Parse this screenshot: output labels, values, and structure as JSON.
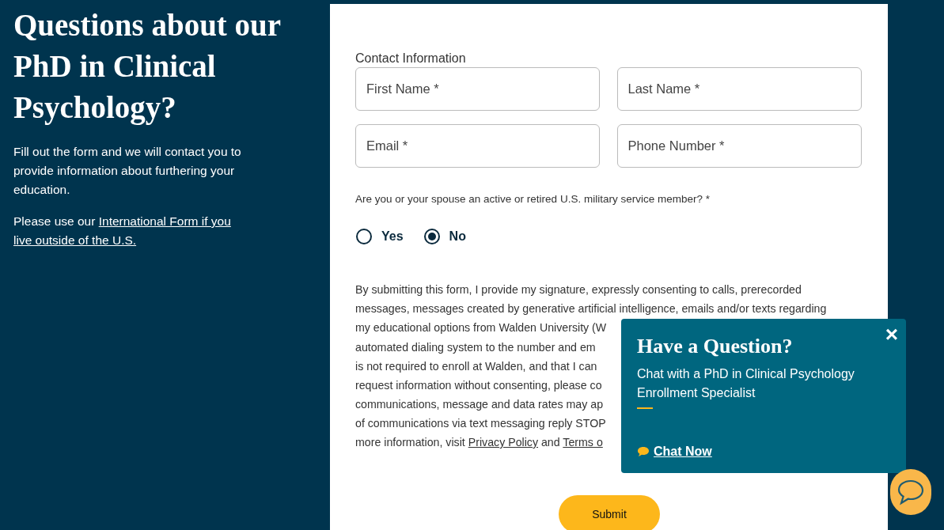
{
  "intro": {
    "heading": "Questions about our PhD in Clinical Psychology?",
    "description": "Fill out the form and we will contact you to provide information about furthering your education.",
    "international": [
      [
        {
          "kind": "text",
          "text": "Please use our "
        },
        {
          "kind": "link",
          "text": "International Form if you"
        }
      ],
      [
        {
          "kind": "link",
          "text": "live outside of the U.S."
        }
      ]
    ]
  },
  "form": {
    "section_label": "Contact Information",
    "fields": [
      {
        "placeholder": "First Name *"
      },
      {
        "placeholder": "Last Name *"
      },
      {
        "placeholder": "Email *"
      },
      {
        "placeholder": "Phone Number *"
      }
    ],
    "military_question": "Are you or your spouse an active or retired U.S. military service member? *",
    "options": [
      {
        "label": "Yes",
        "selected": false
      },
      {
        "label": "No",
        "selected": true
      }
    ],
    "consent_lines": [
      [
        {
          "kind": "text",
          "text": "By submitting this form, I provide my signature, expressly consenting to calls, prerecorded"
        }
      ],
      [
        {
          "kind": "text",
          "text": "messages, messages created by generative artificial intelligence, emails and/or texts regarding"
        }
      ],
      [
        {
          "kind": "text",
          "text": "my educational options from Walden University (W"
        }
      ],
      [
        {
          "kind": "text",
          "text": "automated dialing system to the number and em"
        }
      ],
      [
        {
          "kind": "text",
          "text": "is not required to enroll at Walden, and that I can"
        }
      ],
      [
        {
          "kind": "text",
          "text": "request information without consenting, please co"
        }
      ],
      [
        {
          "kind": "text",
          "text": "communications, message and data rates may ap"
        }
      ],
      [
        {
          "kind": "text",
          "text": "of communications via text messaging reply STOP"
        }
      ],
      [
        {
          "kind": "text",
          "text": "more information, visit "
        },
        {
          "kind": "link",
          "text": "Privacy Policy"
        },
        {
          "kind": "text",
          "text": " and "
        },
        {
          "kind": "link",
          "text": "Terms o"
        }
      ]
    ],
    "submit": "Submit"
  },
  "chat_popup": {
    "close": "×",
    "title": "Have a Question?",
    "text": "Chat with a PhD in Clinical Psychology Enrollment Specialist",
    "link": "Chat Now"
  }
}
